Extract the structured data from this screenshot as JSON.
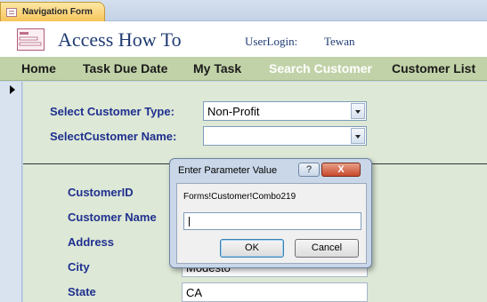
{
  "document_tab": {
    "label": "Navigation Form",
    "icon": "form-icon"
  },
  "header": {
    "app_title": "Access How To",
    "user_label": "UserLogin:",
    "user_name": "Tewan",
    "logo_icon": "database-form-icon"
  },
  "nav": {
    "items": [
      {
        "label": "Home",
        "active": false
      },
      {
        "label": "Task Due Date",
        "active": false
      },
      {
        "label": "My Task",
        "active": false
      },
      {
        "label": "Search Customer",
        "active": true
      },
      {
        "label": "Customer List",
        "active": false
      }
    ]
  },
  "filters": {
    "customer_type_label": "Select Customer Type:",
    "customer_type_value": "Non-Profit",
    "customer_name_label": "SelectCustomer Name:",
    "customer_name_value": ""
  },
  "fields": {
    "customer_id_label": "CustomerID",
    "customer_name_label": "Customer Name",
    "address_label": "Address",
    "city_label": "City",
    "city_value": "Modesto",
    "state_label": "State",
    "state_value": "CA"
  },
  "dialog": {
    "title": "Enter Parameter Value",
    "help_label": "?",
    "close_label": "X",
    "parameter_name": "Forms!Customer!Combo219",
    "input_value": "",
    "ok_label": "OK",
    "cancel_label": "Cancel"
  },
  "colors": {
    "nav_background": "#c2d2a8",
    "detail_background": "#dde8d6",
    "label_color": "#1f2f8f",
    "title_color": "#1f3b73"
  }
}
